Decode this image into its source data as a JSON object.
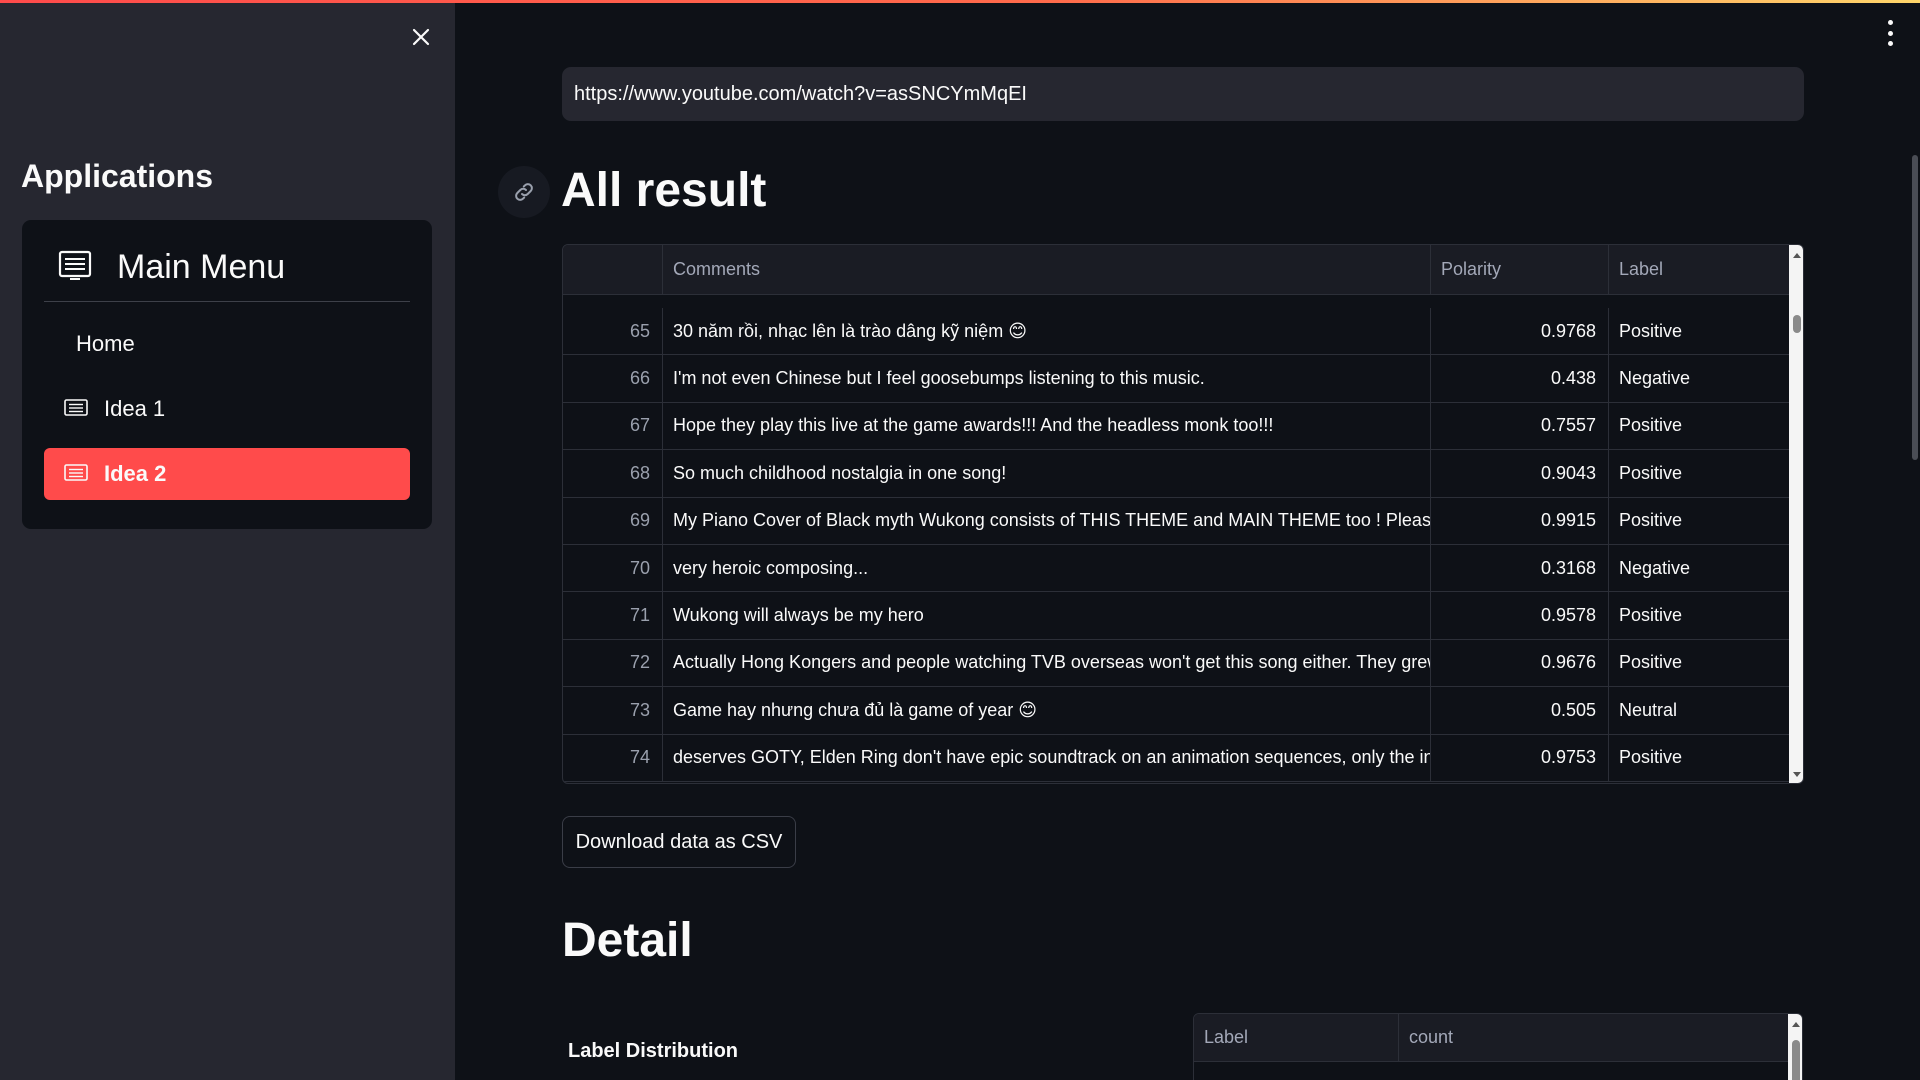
{
  "sidebar": {
    "title": "Applications",
    "menu": {
      "title": "Main Menu",
      "items": [
        {
          "label": "Home",
          "icon": "none",
          "active": false
        },
        {
          "label": "Idea 1",
          "icon": "list-icon",
          "active": false
        },
        {
          "label": "Idea 2",
          "icon": "list-icon",
          "active": true
        }
      ]
    }
  },
  "main": {
    "url_input_value": "https://www.youtube.com/watch?v=asSNCYmMqEI",
    "results_heading": "All result",
    "results_table": {
      "columns": [
        "",
        "Comments",
        "Polarity",
        "Label"
      ],
      "rows": [
        {
          "idx": "65",
          "comment": "30 năm rồi, nhạc lên là trào dâng kỹ niệm 😊",
          "polarity": "0.9768",
          "label": "Positive"
        },
        {
          "idx": "66",
          "comment": "I'm not even Chinese but I feel goosebumps listening to this music.",
          "polarity": "0.438",
          "label": "Negative"
        },
        {
          "idx": "67",
          "comment": "Hope they play this live at the game awards!!!   And the headless monk too!!!",
          "polarity": "0.7557",
          "label": "Positive"
        },
        {
          "idx": "68",
          "comment": "So much childhood nostalgia in one song!",
          "polarity": "0.9043",
          "label": "Positive"
        },
        {
          "idx": "69",
          "comment": "My Piano Cover of Black myth Wukong consists of THIS THEME and MAIN THEME too ! Please visit",
          "polarity": "0.9915",
          "label": "Positive"
        },
        {
          "idx": "70",
          "comment": "very heroic composing...",
          "polarity": "0.3168",
          "label": "Negative"
        },
        {
          "idx": "71",
          "comment": "Wukong will always be my hero",
          "polarity": "0.9578",
          "label": "Positive"
        },
        {
          "idx": "72",
          "comment": "Actually Hong Kongers and people watching TVB overseas won't get this song either. They grew u",
          "polarity": "0.9676",
          "label": "Positive"
        },
        {
          "idx": "73",
          "comment": "Game hay nhưng chưa đủ là game of year 😊",
          "polarity": "0.505",
          "label": "Neutral"
        },
        {
          "idx": "74",
          "comment": "deserves GOTY,  Elden Ring don't have epic soundtrack on an animation sequences, only the intro",
          "polarity": "0.9753",
          "label": "Positive"
        }
      ]
    },
    "download_button": "Download data as CSV",
    "detail_heading": "Detail",
    "label_distribution_title": "Label Distribution",
    "distribution_table": {
      "columns": [
        "Label",
        "count"
      ]
    }
  },
  "colors": {
    "accent": "#ff4b4b",
    "background": "#0e1117",
    "sidebar": "#262730"
  }
}
